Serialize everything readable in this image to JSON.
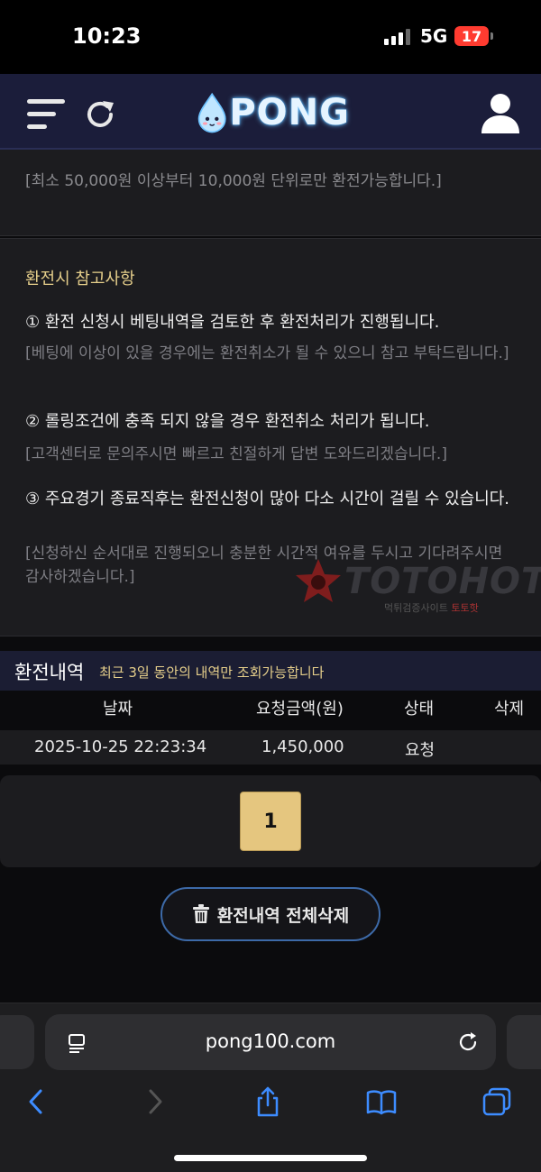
{
  "status_bar": {
    "time": "10:23",
    "network": "5G",
    "battery": "17"
  },
  "header": {
    "logo_text": "PONG",
    "icons": [
      "menu-icon",
      "refresh-icon",
      "user-icon"
    ]
  },
  "notice": {
    "min_text": "[최소 50,000원 이상부터 10,000원 단위로만 환전가능합니다.]",
    "title": "환전시 참고사항",
    "items": [
      {
        "main": "① 환전 신청시 베팅내역을 검토한 후 환전처리가 진행됩니다.",
        "sub": "[베팅에 이상이 있을 경우에는 환전취소가 될 수 있으니 참고 부탁드립니다.]"
      },
      {
        "main": "② 롤링조건에 충족 되지 않을 경우 환전취소 처리가 됩니다.",
        "sub": "[고객센터로 문의주시면 빠르고 친절하게 답변 도와드리겠습니다.]"
      },
      {
        "main": "③ 주요경기 종료직후는 환전신청이 많아 다소 시간이 걸릴 수 있습니다.",
        "sub": "[신청하신 순서대로 진행되오니 충분한 시간적 여유를 두시고 기다려주시면 감사하겠습니다.]"
      }
    ]
  },
  "watermark": {
    "text": "TOTOHOT",
    "sub_prefix": "먹튀검증사이트 ",
    "sub_brand": "토토핫"
  },
  "history": {
    "title": "환전내역",
    "subtitle": "최근 3일 동안의 내역만 조회가능합니다",
    "columns": [
      "날짜",
      "요청금액(원)",
      "상태",
      "삭제"
    ],
    "rows": [
      {
        "date": "2025-10-25 22:23:34",
        "amount": "1,450,000",
        "status": "요청",
        "delete": ""
      }
    ],
    "current_page": "1",
    "delete_all_label": "환전내역 전체삭제"
  },
  "browser": {
    "url": "pong100.com"
  },
  "colors": {
    "header_bg": "#1b1d3a",
    "accent_gold": "#e5c67f",
    "panel_bg": "#1c1c1f",
    "button_border": "#3d6aa8"
  }
}
